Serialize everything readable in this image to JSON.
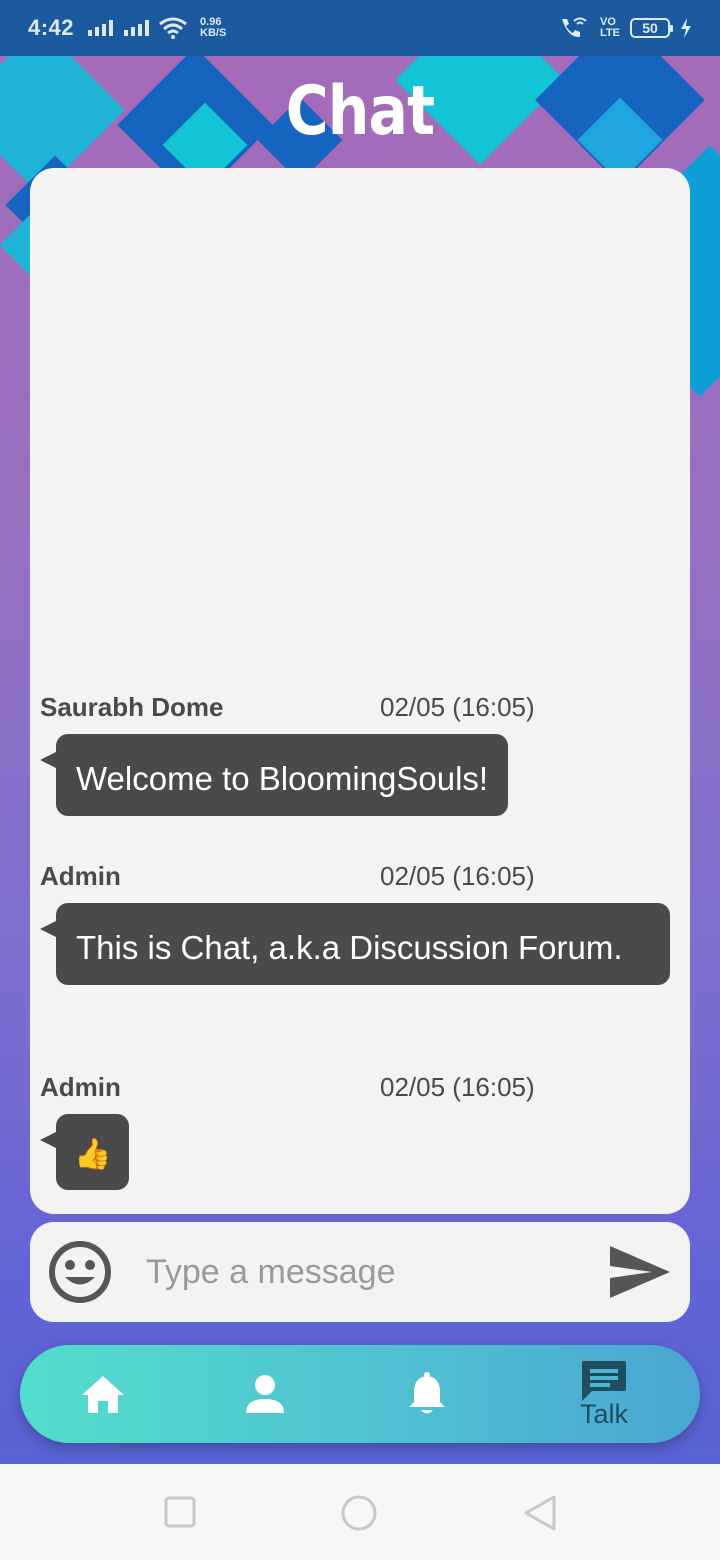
{
  "status_bar": {
    "time": "4:42",
    "net_speed_value": "0.96",
    "net_speed_unit": "KB/S",
    "volte_top": "VO",
    "volte_bottom": "LTE",
    "battery": "50"
  },
  "header": {
    "title": "Chat"
  },
  "messages": [
    {
      "author": "Saurabh Dome",
      "time": "02/05 (16:05)",
      "text": "Welcome to BloomingSouls!"
    },
    {
      "author": "Admin",
      "time": "02/05 (16:05)",
      "text": "This is Chat, a.k.a Discussion Forum."
    },
    {
      "author": "Admin",
      "time": "02/05 (16:05)",
      "text": "👍"
    }
  ],
  "composer": {
    "placeholder": "Type a message",
    "emoji_icon": "smiley-icon",
    "send_icon": "send-icon"
  },
  "nav": {
    "items": [
      {
        "icon": "home-icon",
        "label": ""
      },
      {
        "icon": "person-icon",
        "label": ""
      },
      {
        "icon": "bell-icon",
        "label": ""
      },
      {
        "icon": "chat-icon",
        "label": "Talk"
      }
    ]
  },
  "colors": {
    "bubble": "#4a4a4a",
    "status_bar": "#1b5a9e",
    "nav_start": "#53ddcb",
    "nav_end": "#4aa6d2"
  }
}
